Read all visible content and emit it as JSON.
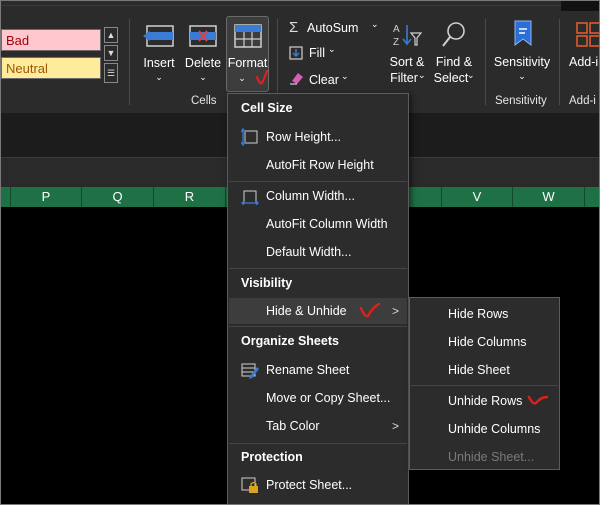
{
  "styles": {
    "bad": "Bad",
    "neutral": "Neutral"
  },
  "ribbon": {
    "insert": "Insert",
    "delete": "Delete",
    "format": "Format",
    "autosum": "AutoSum",
    "fill": "Fill",
    "clear": "Clear",
    "sort_filter_1": "Sort &",
    "sort_filter_2": "Filter",
    "find_select_1": "Find &",
    "find_select_2": "Select",
    "sensitivity": "Sensitivity",
    "addin": "Add-in",
    "group_cells": "Cells",
    "group_sensitivity": "Sensitivity",
    "group_addin": "Add-i"
  },
  "columns": [
    "P",
    "Q",
    "R",
    "V",
    "W"
  ],
  "menu": {
    "cell_size_header": "Cell Size",
    "row_height": "Row Height...",
    "autofit_row_height": "AutoFit Row Height",
    "column_width": "Column Width...",
    "autofit_column_width": "AutoFit Column Width",
    "default_width": "Default Width...",
    "visibility_header": "Visibility",
    "hide_unhide": "Hide & Unhide",
    "organize_header": "Organize Sheets",
    "rename_sheet": "Rename Sheet",
    "move_copy_sheet": "Move or Copy Sheet...",
    "tab_color": "Tab Color",
    "protection_header": "Protection",
    "protect_sheet": "Protect Sheet..."
  },
  "submenu": {
    "hide_rows": "Hide Rows",
    "hide_columns": "Hide Columns",
    "hide_sheet": "Hide Sheet",
    "unhide_rows": "Unhide Rows",
    "unhide_columns": "Unhide Columns",
    "unhide_sheet": "Unhide Sheet..."
  },
  "colors": {
    "accent_green": "#1e7145",
    "annotation_red": "#e0201c",
    "bad_fill": "#ffc7ce",
    "neutral_fill": "#ffeb9c"
  }
}
